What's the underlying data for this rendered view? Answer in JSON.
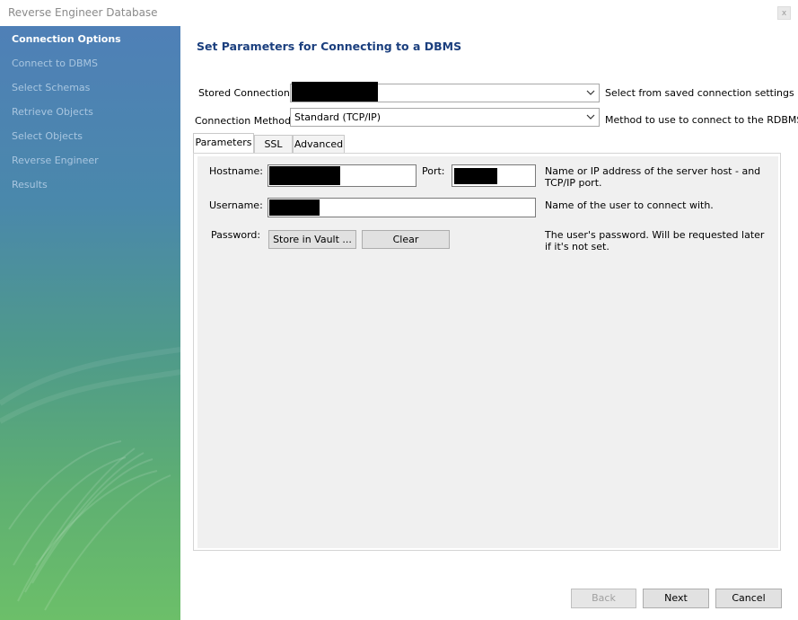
{
  "window": {
    "title": "Reverse Engineer Database",
    "close_label": "x"
  },
  "sidebar": {
    "items": [
      {
        "label": "Connection Options",
        "active": true
      },
      {
        "label": "Connect to DBMS"
      },
      {
        "label": "Select Schemas"
      },
      {
        "label": "Retrieve Objects"
      },
      {
        "label": "Select Objects"
      },
      {
        "label": "Reverse Engineer"
      },
      {
        "label": "Results"
      }
    ]
  },
  "page": {
    "title": "Set Parameters for Connecting to a DBMS",
    "stored_connection": {
      "label": "Stored Connection:",
      "value": "",
      "hint": "Select from saved connection settings"
    },
    "connection_method": {
      "label": "Connection Method:",
      "value": "Standard (TCP/IP)",
      "hint": "Method to use to connect to the RDBMS"
    },
    "tabs": [
      {
        "label": "Parameters",
        "active": true
      },
      {
        "label": "SSL"
      },
      {
        "label": "Advanced"
      }
    ],
    "params": {
      "hostname_label": "Hostname:",
      "hostname_value": "",
      "port_label": "Port:",
      "port_value": "",
      "host_hint": "Name or IP address of the server host - and TCP/IP port.",
      "username_label": "Username:",
      "username_value": "",
      "username_hint": "Name of the user to connect with.",
      "password_label": "Password:",
      "store_vault_label": "Store in Vault ...",
      "clear_label": "Clear",
      "password_hint": "The user's password. Will be requested later if it's not set."
    }
  },
  "footer": {
    "back_label": "Back",
    "next_label": "Next",
    "cancel_label": "Cancel"
  },
  "colors": {
    "title_blue": "#1b3f7e",
    "sidebar_top": "#4f80b7",
    "sidebar_bottom": "#6cbf69"
  }
}
